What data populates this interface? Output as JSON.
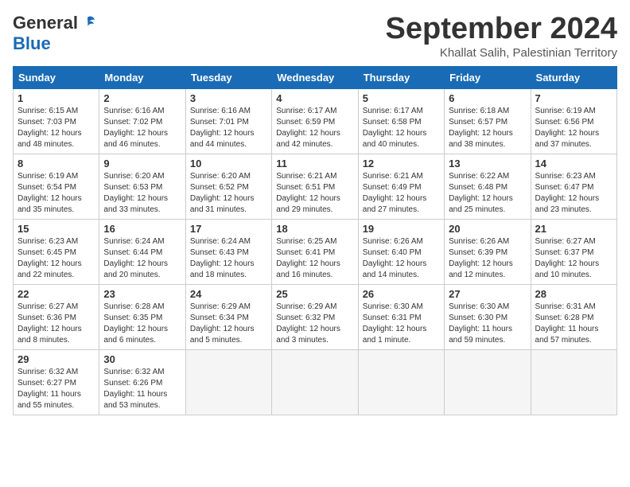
{
  "header": {
    "logo_general": "General",
    "logo_blue": "Blue",
    "month_year": "September 2024",
    "location": "Khallat Salih, Palestinian Territory"
  },
  "weekdays": [
    "Sunday",
    "Monday",
    "Tuesday",
    "Wednesday",
    "Thursday",
    "Friday",
    "Saturday"
  ],
  "weeks": [
    [
      {
        "day": "1",
        "info": "Sunrise: 6:15 AM\nSunset: 7:03 PM\nDaylight: 12 hours\nand 48 minutes."
      },
      {
        "day": "2",
        "info": "Sunrise: 6:16 AM\nSunset: 7:02 PM\nDaylight: 12 hours\nand 46 minutes."
      },
      {
        "day": "3",
        "info": "Sunrise: 6:16 AM\nSunset: 7:01 PM\nDaylight: 12 hours\nand 44 minutes."
      },
      {
        "day": "4",
        "info": "Sunrise: 6:17 AM\nSunset: 6:59 PM\nDaylight: 12 hours\nand 42 minutes."
      },
      {
        "day": "5",
        "info": "Sunrise: 6:17 AM\nSunset: 6:58 PM\nDaylight: 12 hours\nand 40 minutes."
      },
      {
        "day": "6",
        "info": "Sunrise: 6:18 AM\nSunset: 6:57 PM\nDaylight: 12 hours\nand 38 minutes."
      },
      {
        "day": "7",
        "info": "Sunrise: 6:19 AM\nSunset: 6:56 PM\nDaylight: 12 hours\nand 37 minutes."
      }
    ],
    [
      {
        "day": "8",
        "info": "Sunrise: 6:19 AM\nSunset: 6:54 PM\nDaylight: 12 hours\nand 35 minutes."
      },
      {
        "day": "9",
        "info": "Sunrise: 6:20 AM\nSunset: 6:53 PM\nDaylight: 12 hours\nand 33 minutes."
      },
      {
        "day": "10",
        "info": "Sunrise: 6:20 AM\nSunset: 6:52 PM\nDaylight: 12 hours\nand 31 minutes."
      },
      {
        "day": "11",
        "info": "Sunrise: 6:21 AM\nSunset: 6:51 PM\nDaylight: 12 hours\nand 29 minutes."
      },
      {
        "day": "12",
        "info": "Sunrise: 6:21 AM\nSunset: 6:49 PM\nDaylight: 12 hours\nand 27 minutes."
      },
      {
        "day": "13",
        "info": "Sunrise: 6:22 AM\nSunset: 6:48 PM\nDaylight: 12 hours\nand 25 minutes."
      },
      {
        "day": "14",
        "info": "Sunrise: 6:23 AM\nSunset: 6:47 PM\nDaylight: 12 hours\nand 23 minutes."
      }
    ],
    [
      {
        "day": "15",
        "info": "Sunrise: 6:23 AM\nSunset: 6:45 PM\nDaylight: 12 hours\nand 22 minutes."
      },
      {
        "day": "16",
        "info": "Sunrise: 6:24 AM\nSunset: 6:44 PM\nDaylight: 12 hours\nand 20 minutes."
      },
      {
        "day": "17",
        "info": "Sunrise: 6:24 AM\nSunset: 6:43 PM\nDaylight: 12 hours\nand 18 minutes."
      },
      {
        "day": "18",
        "info": "Sunrise: 6:25 AM\nSunset: 6:41 PM\nDaylight: 12 hours\nand 16 minutes."
      },
      {
        "day": "19",
        "info": "Sunrise: 6:26 AM\nSunset: 6:40 PM\nDaylight: 12 hours\nand 14 minutes."
      },
      {
        "day": "20",
        "info": "Sunrise: 6:26 AM\nSunset: 6:39 PM\nDaylight: 12 hours\nand 12 minutes."
      },
      {
        "day": "21",
        "info": "Sunrise: 6:27 AM\nSunset: 6:37 PM\nDaylight: 12 hours\nand 10 minutes."
      }
    ],
    [
      {
        "day": "22",
        "info": "Sunrise: 6:27 AM\nSunset: 6:36 PM\nDaylight: 12 hours\nand 8 minutes."
      },
      {
        "day": "23",
        "info": "Sunrise: 6:28 AM\nSunset: 6:35 PM\nDaylight: 12 hours\nand 6 minutes."
      },
      {
        "day": "24",
        "info": "Sunrise: 6:29 AM\nSunset: 6:34 PM\nDaylight: 12 hours\nand 5 minutes."
      },
      {
        "day": "25",
        "info": "Sunrise: 6:29 AM\nSunset: 6:32 PM\nDaylight: 12 hours\nand 3 minutes."
      },
      {
        "day": "26",
        "info": "Sunrise: 6:30 AM\nSunset: 6:31 PM\nDaylight: 12 hours\nand 1 minute."
      },
      {
        "day": "27",
        "info": "Sunrise: 6:30 AM\nSunset: 6:30 PM\nDaylight: 11 hours\nand 59 minutes."
      },
      {
        "day": "28",
        "info": "Sunrise: 6:31 AM\nSunset: 6:28 PM\nDaylight: 11 hours\nand 57 minutes."
      }
    ],
    [
      {
        "day": "29",
        "info": "Sunrise: 6:32 AM\nSunset: 6:27 PM\nDaylight: 11 hours\nand 55 minutes."
      },
      {
        "day": "30",
        "info": "Sunrise: 6:32 AM\nSunset: 6:26 PM\nDaylight: 11 hours\nand 53 minutes."
      },
      {
        "day": "",
        "info": ""
      },
      {
        "day": "",
        "info": ""
      },
      {
        "day": "",
        "info": ""
      },
      {
        "day": "",
        "info": ""
      },
      {
        "day": "",
        "info": ""
      }
    ]
  ]
}
